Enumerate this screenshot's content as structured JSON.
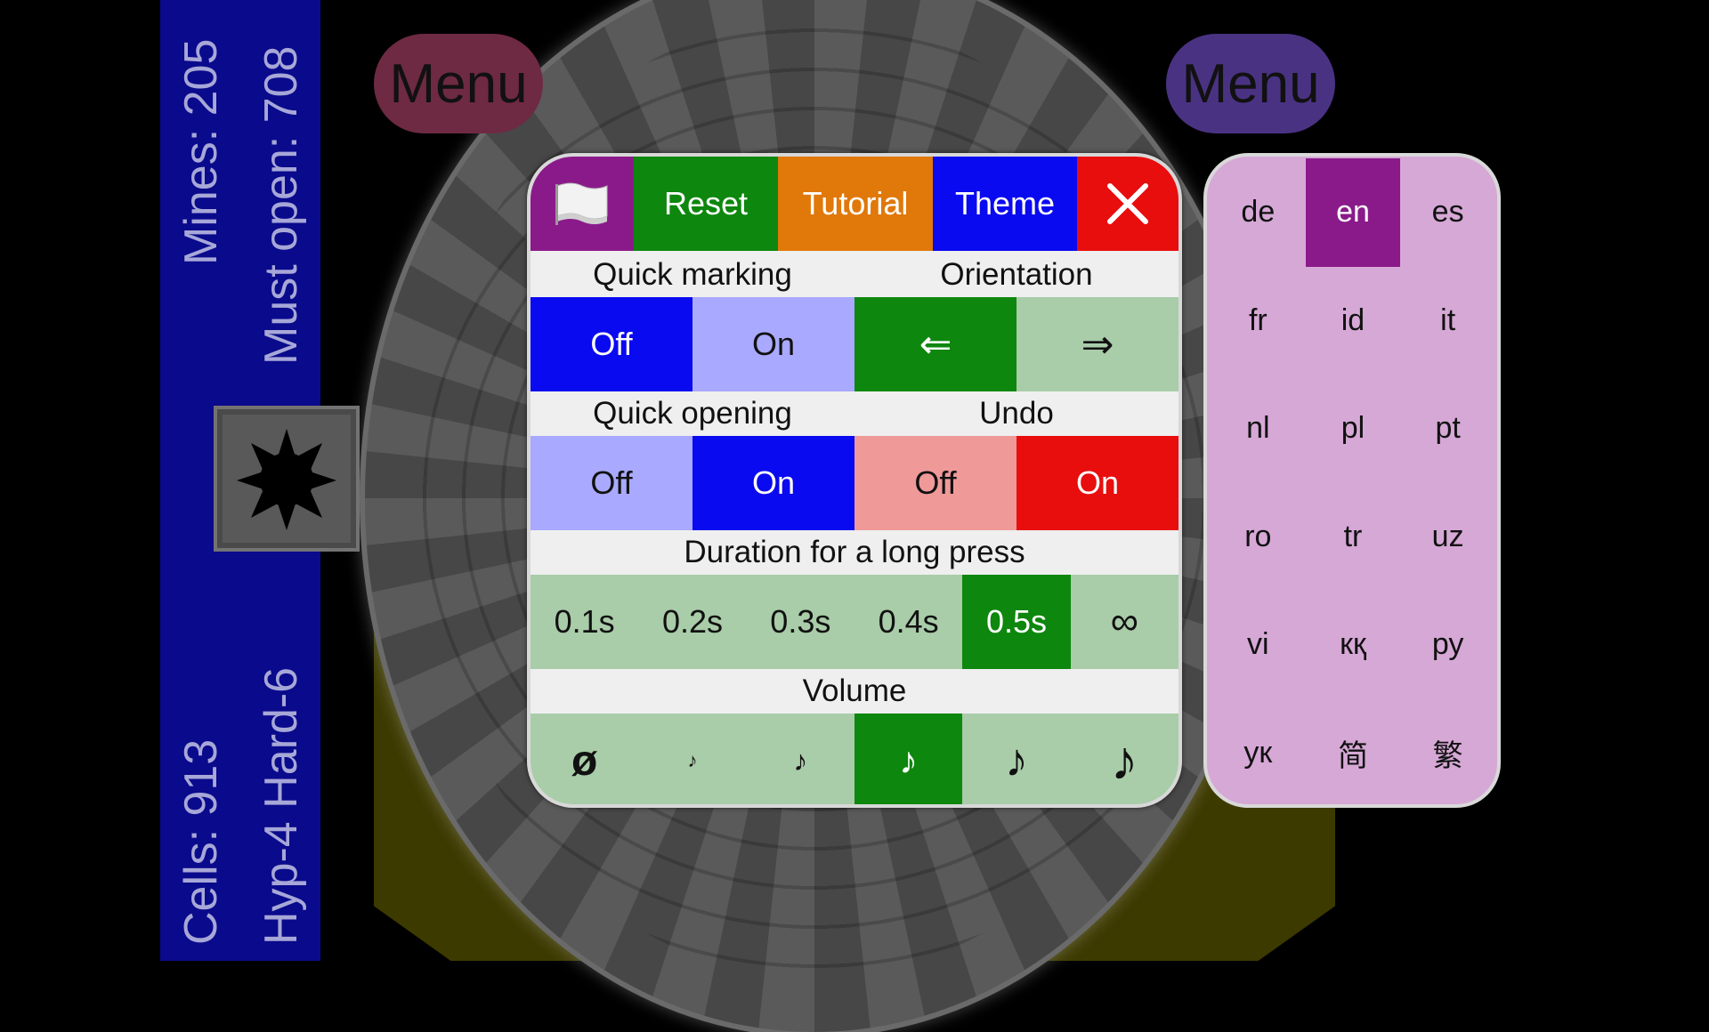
{
  "status": {
    "mines": "Mines: 205",
    "must_open": "Must open: 708",
    "cells": "Cells: 913",
    "level": "Hyp-4 Hard-6"
  },
  "menus": {
    "left": "Menu",
    "right": "Menu"
  },
  "toolbar": {
    "flag_icon": "flag-icon",
    "reset": "Reset",
    "tutorial": "Tutorial",
    "theme": "Theme",
    "close_icon": "close-icon"
  },
  "settings": {
    "quick_marking": {
      "label": "Quick marking",
      "off": "Off",
      "on": "On",
      "selected": "Off"
    },
    "orientation": {
      "label": "Orientation",
      "left": "⇐",
      "right": "⇒",
      "selected": "left"
    },
    "quick_opening": {
      "label": "Quick opening",
      "off": "Off",
      "on": "On",
      "selected": "On"
    },
    "undo": {
      "label": "Undo",
      "off": "Off",
      "on": "On",
      "selected": "On"
    },
    "long_press": {
      "label": "Duration for a long press",
      "options": [
        "0.1s",
        "0.2s",
        "0.3s",
        "0.4s",
        "0.5s",
        "∞"
      ],
      "selected": "0.5s"
    },
    "volume": {
      "label": "Volume",
      "mute": "ø",
      "levels": 5,
      "selected_level": 3
    }
  },
  "languages": {
    "items": [
      "de",
      "en",
      "es",
      "fr",
      "id",
      "it",
      "nl",
      "pl",
      "pt",
      "ro",
      "tr",
      "uz",
      "vi",
      "кқ",
      "ру",
      "ук",
      "简",
      "繁"
    ],
    "selected": "en"
  },
  "colors": {
    "status_bar": "#0a0a8c",
    "selected_purple": "#8a1a8a",
    "green": "#0d870d",
    "blue": "#0a0af0",
    "red": "#e80e0e",
    "orange": "#e0780a"
  }
}
